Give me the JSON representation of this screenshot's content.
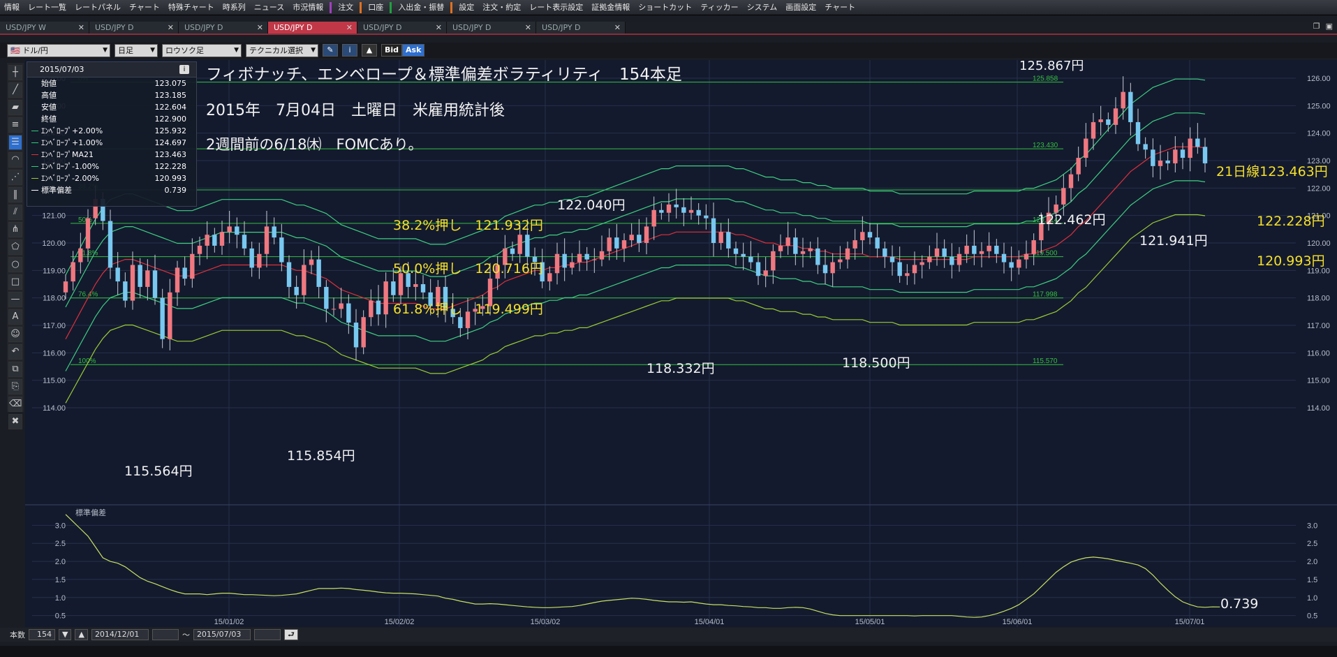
{
  "menu": {
    "items": [
      "情報",
      "レート一覧",
      "レートパネル",
      "チャート",
      "特殊チャート",
      "時系列",
      "ニュース",
      "市況情報",
      "注文",
      "口座",
      "入出金・振替",
      "設定",
      "注文・約定",
      "レート表示設定",
      "証拠金情報",
      "ショートカット",
      "ティッカー",
      "システム",
      "画面設定",
      "チャート"
    ]
  },
  "tabs": [
    {
      "label": "USD/JPY W",
      "active": false
    },
    {
      "label": "USD/JPY D",
      "active": false
    },
    {
      "label": "USD/JPY D",
      "active": false
    },
    {
      "label": "USD/JPY D",
      "active": true
    },
    {
      "label": "USD/JPY D",
      "active": false
    },
    {
      "label": "USD/JPY D",
      "active": false
    },
    {
      "label": "USD/JPY D",
      "active": false
    }
  ],
  "toolbar": {
    "pair": "ドル/円",
    "period": "日足",
    "chart_type": "ロウソク足",
    "technical": "テクニカル選択",
    "bid": "Bid",
    "ask": "Ask"
  },
  "info": {
    "date": "2015/07/03",
    "rows": [
      {
        "label": "始値",
        "value": "123.075",
        "color": ""
      },
      {
        "label": "高値",
        "value": "123.185",
        "color": ""
      },
      {
        "label": "安値",
        "value": "122.604",
        "color": ""
      },
      {
        "label": "終値",
        "value": "122.900",
        "color": ""
      },
      {
        "label": "ｴﾝﾍﾞﾛｰﾌﾟ+2.00%",
        "value": "125.932",
        "color": "#2ecf7a"
      },
      {
        "label": "ｴﾝﾍﾞﾛｰﾌﾟ+1.00%",
        "value": "124.697",
        "color": "#2ecf7a"
      },
      {
        "label": "ｴﾝﾍﾞﾛｰﾌﾟMA21",
        "value": "123.463",
        "color": "#e0303a"
      },
      {
        "label": "ｴﾝﾍﾞﾛｰﾌﾟ-1.00%",
        "value": "122.228",
        "color": "#2ecf7a"
      },
      {
        "label": "ｴﾝﾍﾞﾛｰﾌﾟ-2.00%",
        "value": "120.993",
        "color": "#9acd32"
      },
      {
        "label": "標準偏差",
        "value": "0.739",
        "color": "#ffffff"
      }
    ]
  },
  "annotations": {
    "title": "フィボナッチ、エンベロープ＆標準偏差ボラティリティ　154本足",
    "line2": "2015年　7月04日　土曜日　米雇用統計後",
    "line3": "2週間前の6/18㈭　FOMCあり。",
    "fib382": "38.2%押し　121.932円",
    "fib500": "50.0%押し　120.716円",
    "fib618": "61.8%押し　119.499円",
    "high_label": "125.867円",
    "low1": "115.564円",
    "low2": "115.854円",
    "p122040": "122.040円",
    "p118332": "118.332円",
    "p118500": "118.500円",
    "p122462": "122.462円",
    "p121941": "121.941円",
    "ma21_label": "21日線123.463円",
    "env_m1": "122.228円",
    "env_m2": "120.993円",
    "stdev_val": "0.739",
    "stdev_title": "標準偏差"
  },
  "chart_data": {
    "type": "candlestick",
    "y_ticks": [
      "126.00",
      "125.00",
      "124.00",
      "123.00",
      "122.00",
      "121.00",
      "120.00",
      "119.00",
      "118.00",
      "117.00",
      "116.00",
      "115.00",
      "114.00"
    ],
    "ylim": [
      114,
      126.4
    ],
    "x_labels": [
      "15/01/02",
      "15/02/02",
      "15/03/02",
      "15/04/01",
      "15/05/01",
      "15/06/01",
      "15/07/01"
    ],
    "fib_levels": [
      {
        "pct": "0%",
        "value": 125.858,
        "label": "125.858"
      },
      {
        "pct": "23.6%",
        "value": 123.43,
        "label": "123.430"
      },
      {
        "pct": "38.2%",
        "value": 121.932,
        "label": ""
      },
      {
        "pct": "50%",
        "value": 120.714,
        "label": "120.714"
      },
      {
        "pct": "61.8%",
        "value": 119.5,
        "label": "119.500"
      },
      {
        "pct": "76.4%",
        "value": 117.998,
        "label": "117.998"
      },
      {
        "pct": "100%",
        "value": 115.57,
        "label": "115.570"
      }
    ],
    "close": [
      118.6,
      119.3,
      119.8,
      120.9,
      121.6,
      120.8,
      119.1,
      118.6,
      117.9,
      119.2,
      118.4,
      119.0,
      118.0,
      116.5,
      118.2,
      119.1,
      118.7,
      119.6,
      119.9,
      120.3,
      119.9,
      120.4,
      120.6,
      120.3,
      119.8,
      119.1,
      119.6,
      120.6,
      120.2,
      119.3,
      118.4,
      118.1,
      119.2,
      119.4,
      118.4,
      117.6,
      117.6,
      117.8,
      117.1,
      116.2,
      117.3,
      117.9,
      117.4,
      118.6,
      118.1,
      118.9,
      118.4,
      118.5,
      118.2,
      117.7,
      118.4,
      117.6,
      117.3,
      116.9,
      117.5,
      117.6,
      117.7,
      118.7,
      119.2,
      119.8,
      119.6,
      120.3,
      119.5,
      119.3,
      118.6,
      118.9,
      119.6,
      119.1,
      119.3,
      119.6,
      119.4,
      119.4,
      119.7,
      120.2,
      119.8,
      120.1,
      120.3,
      120.0,
      120.6,
      121.2,
      121.1,
      121.4,
      121.3,
      121.1,
      121.2,
      121.0,
      120.9,
      120.0,
      120.4,
      119.8,
      119.6,
      119.5,
      119.3,
      118.8,
      119.0,
      119.7,
      119.9,
      120.2,
      119.6,
      119.7,
      119.8,
      119.2,
      118.9,
      119.3,
      119.4,
      119.8,
      120.1,
      120.4,
      120.2,
      119.8,
      119.5,
      119.3,
      118.8,
      118.9,
      119.2,
      119.3,
      119.5,
      119.8,
      119.5,
      119.2,
      119.6,
      119.9,
      119.6,
      119.7,
      119.9,
      119.6,
      119.3,
      119.1,
      119.4,
      119.6,
      120.1,
      120.7,
      121.1,
      121.4,
      122.0,
      122.5,
      123.1,
      123.8,
      124.4,
      124.5,
      124.3,
      124.9,
      125.5,
      124.4,
      123.6,
      123.4,
      122.8,
      123.0,
      122.9,
      123.4,
      123.1,
      123.8,
      123.5,
      122.9
    ],
    "ma21": [
      116.5,
      117.0,
      117.5,
      118.0,
      118.5,
      118.9,
      119.2,
      119.3,
      119.4,
      119.4,
      119.3,
      119.2,
      119.1,
      119.0,
      118.9,
      118.8,
      118.8,
      118.8,
      118.9,
      119.0,
      119.1,
      119.2,
      119.2,
      119.2,
      119.2,
      119.2,
      119.2,
      119.2,
      119.2,
      119.2,
      119.1,
      119.0,
      119.0,
      118.9,
      118.8,
      118.7,
      118.5,
      118.3,
      118.2,
      118.1,
      118.0,
      117.9,
      117.8,
      117.8,
      117.8,
      117.8,
      117.8,
      117.8,
      117.7,
      117.6,
      117.6,
      117.6,
      117.7,
      117.8,
      117.9,
      118.0,
      118.1,
      118.3,
      118.4,
      118.6,
      118.7,
      118.8,
      118.9,
      119.0,
      119.0,
      119.1,
      119.1,
      119.2,
      119.2,
      119.3,
      119.3,
      119.4,
      119.5,
      119.6,
      119.7,
      119.8,
      119.9,
      120.0,
      120.1,
      120.2,
      120.3,
      120.3,
      120.4,
      120.4,
      120.4,
      120.4,
      120.4,
      120.4,
      120.4,
      120.4,
      120.3,
      120.3,
      120.2,
      120.1,
      120.0,
      120.0,
      119.9,
      119.9,
      119.9,
      119.8,
      119.8,
      119.7,
      119.7,
      119.6,
      119.6,
      119.6,
      119.6,
      119.6,
      119.5,
      119.5,
      119.5,
      119.5,
      119.4,
      119.4,
      119.4,
      119.4,
      119.4,
      119.4,
      119.4,
      119.4,
      119.4,
      119.4,
      119.5,
      119.5,
      119.5,
      119.5,
      119.5,
      119.5,
      119.5,
      119.6,
      119.6,
      119.7,
      119.8,
      119.9,
      120.1,
      120.3,
      120.6,
      120.8,
      121.1,
      121.4,
      121.7,
      122.0,
      122.3,
      122.6,
      122.8,
      123.0,
      123.2,
      123.3,
      123.4,
      123.5,
      123.5,
      123.5,
      123.5,
      123.46
    ],
    "stdev": [
      3.3,
      3.1,
      2.9,
      2.7,
      2.4,
      2.1,
      2.0,
      1.95,
      1.85,
      1.7,
      1.55,
      1.45,
      1.38,
      1.3,
      1.22,
      1.15,
      1.1,
      1.1,
      1.1,
      1.08,
      1.1,
      1.12,
      1.12,
      1.1,
      1.08,
      1.08,
      1.07,
      1.06,
      1.05,
      1.06,
      1.08,
      1.1,
      1.15,
      1.2,
      1.25,
      1.25,
      1.25,
      1.26,
      1.25,
      1.22,
      1.2,
      1.18,
      1.15,
      1.13,
      1.12,
      1.12,
      1.11,
      1.1,
      1.08,
      1.06,
      1.04,
      0.98,
      0.95,
      0.9,
      0.86,
      0.82,
      0.82,
      0.83,
      0.82,
      0.8,
      0.78,
      0.76,
      0.74,
      0.73,
      0.72,
      0.72,
      0.73,
      0.74,
      0.75,
      0.78,
      0.82,
      0.86,
      0.9,
      0.92,
      0.94,
      0.96,
      0.98,
      0.97,
      0.95,
      0.92,
      0.9,
      0.88,
      0.88,
      0.87,
      0.88,
      0.85,
      0.82,
      0.8,
      0.8,
      0.78,
      0.77,
      0.75,
      0.74,
      0.72,
      0.72,
      0.7,
      0.7,
      0.72,
      0.73,
      0.72,
      0.68,
      0.62,
      0.56,
      0.52,
      0.5,
      0.5,
      0.5,
      0.5,
      0.5,
      0.5,
      0.5,
      0.5,
      0.5,
      0.5,
      0.49,
      0.5,
      0.5,
      0.5,
      0.5,
      0.5,
      0.48,
      0.46,
      0.45,
      0.46,
      0.5,
      0.55,
      0.62,
      0.7,
      0.8,
      0.95,
      1.1,
      1.3,
      1.5,
      1.7,
      1.85,
      1.98,
      2.05,
      2.1,
      2.12,
      2.1,
      2.07,
      2.03,
      1.99,
      1.95,
      1.9,
      1.8,
      1.62,
      1.4,
      1.2,
      1.02,
      0.88,
      0.8,
      0.74,
      0.73,
      0.74,
      0.739
    ],
    "stdev_ticks": [
      "3.0",
      "2.5",
      "2.0",
      "1.5",
      "1.0",
      "0.5"
    ]
  },
  "bottom": {
    "label": "本数",
    "count": "154",
    "from": "2014/12/01",
    "tilde": "～",
    "to": "2015/07/03"
  }
}
